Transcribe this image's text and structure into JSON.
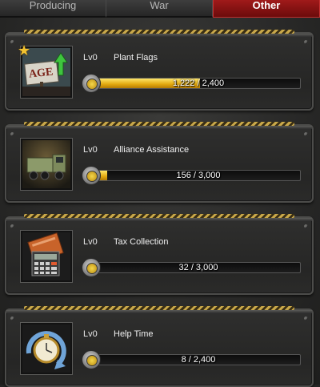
{
  "tabs": [
    {
      "label": "Producing"
    },
    {
      "label": "War"
    },
    {
      "label": "Other"
    }
  ],
  "items": [
    {
      "level": "Lv0",
      "title": "Plant Flags",
      "progress_text": "1,222 / 2,400",
      "progress": 0.509,
      "icon": "flag-billboard-icon",
      "starred": true
    },
    {
      "level": "Lv0",
      "title": "Alliance Assistance",
      "progress_text": "156 / 3,000",
      "progress": 0.052,
      "icon": "armored-truck-icon",
      "starred": false
    },
    {
      "level": "Lv0",
      "title": "Tax Collection",
      "progress_text": "32 / 3,000",
      "progress": 0.011,
      "icon": "calculator-icon",
      "starred": false
    },
    {
      "level": "Lv0",
      "title": "Help Time",
      "progress_text": "8 / 2,400",
      "progress": 0.003,
      "icon": "pocket-watch-icon",
      "starred": false
    }
  ],
  "thumb_text": "AGE",
  "colors": {
    "active_tab": "#8b1111",
    "progress_fill": "#e2a80e",
    "star": "#f2c230"
  }
}
